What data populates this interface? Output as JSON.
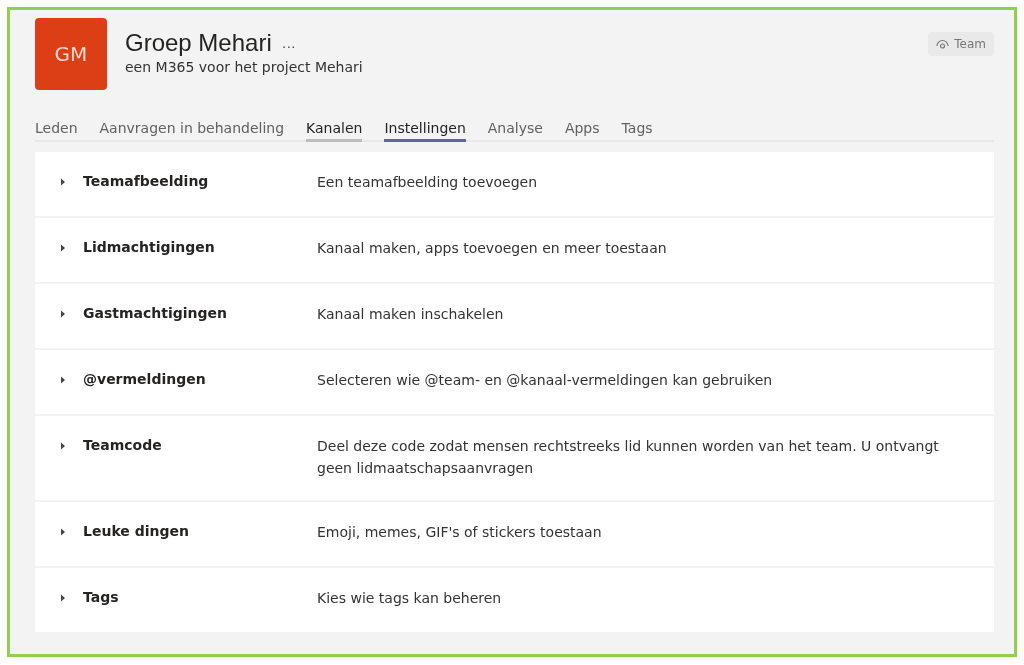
{
  "team": {
    "initials": "GM",
    "name": "Groep Mehari",
    "description": "een M365 voor het project Mehari",
    "more": "···",
    "badge": "Team"
  },
  "tabs": [
    {
      "label": "Leden",
      "selected": false,
      "hovered": false
    },
    {
      "label": "Aanvragen in behandeling",
      "selected": false,
      "hovered": false
    },
    {
      "label": "Kanalen",
      "selected": false,
      "hovered": true
    },
    {
      "label": "Instellingen",
      "selected": true,
      "hovered": false
    },
    {
      "label": "Analyse",
      "selected": false,
      "hovered": false
    },
    {
      "label": "Apps",
      "selected": false,
      "hovered": false
    },
    {
      "label": "Tags",
      "selected": false,
      "hovered": false
    }
  ],
  "settings": [
    {
      "title": "Teamafbeelding",
      "description": "Een teamafbeelding toevoegen",
      "expanded": false
    },
    {
      "title": "Lidmachtigingen",
      "description": "Kanaal maken, apps toevoegen en meer toestaan",
      "expanded": false
    },
    {
      "title": "Gastmachtigingen",
      "description": "Kanaal maken inschakelen",
      "expanded": false
    },
    {
      "title": "@vermeldingen",
      "description": "Selecteren wie @team- en @kanaal-vermeldingen kan gebruiken",
      "expanded": false
    },
    {
      "title": "Teamcode",
      "description": "Deel deze code zodat mensen rechtstreeks lid kunnen worden van het team. U ontvangt geen lidmaatschapsaanvragen",
      "expanded": false
    },
    {
      "title": "Leuke dingen",
      "description": "Emoji, memes, GIF's of stickers toestaan",
      "expanded": false
    },
    {
      "title": "Tags",
      "description": "Kies wie tags kan beheren",
      "expanded": false
    }
  ]
}
